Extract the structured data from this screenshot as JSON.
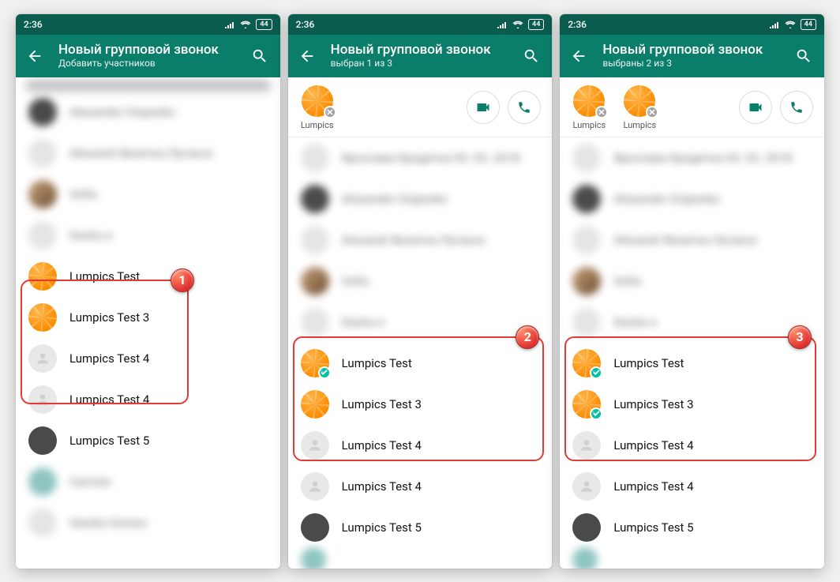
{
  "status": {
    "time": "2:36",
    "battery": "44"
  },
  "header": {
    "title": "Новый групповой звонок",
    "sub_add": "Добавить участников",
    "sub_sel1": "выбран 1 из 3",
    "sub_sel2": "выбраны 2 из 3"
  },
  "chips": {
    "lumpics": "Lumpics"
  },
  "blurNames": {
    "a": "Ярослава Кредитка 05. 02. 2018",
    "b": "Alexander Osipenko",
    "c": "Alexandr Визитка Луганск",
    "d": "Sofia",
    "e": "Dasha ●",
    "f": "Carmen",
    "g": "Sandra Gomez"
  },
  "contacts": {
    "lt": "Lumpics Test",
    "lt3": "Lumpics Test 3",
    "lt4": "Lumpics Test 4",
    "lt4b": "Lumpics Test 4",
    "lt5": "Lumpics Test 5"
  },
  "badges": {
    "b1": "1",
    "b2": "2",
    "b3": "3"
  }
}
